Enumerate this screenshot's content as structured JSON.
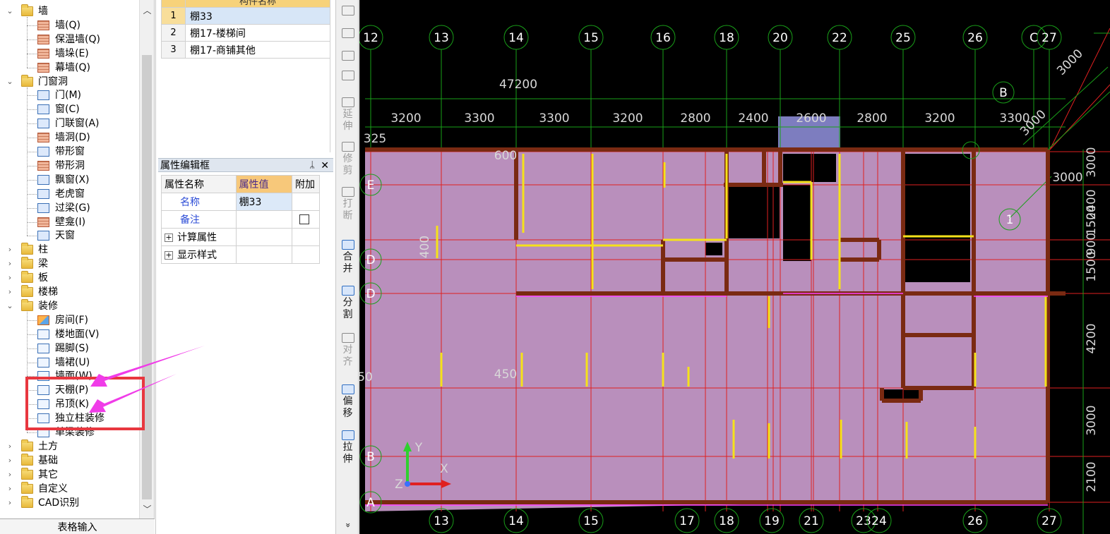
{
  "tree": {
    "items": [
      {
        "label": "墙",
        "type": "folder",
        "state": "open",
        "depth": 0
      },
      {
        "label": "墙(Q)",
        "type": "leaf",
        "icon": "brick-wall-icon",
        "style": "brick",
        "depth": 1
      },
      {
        "label": "保温墙(Q)",
        "type": "leaf",
        "icon": "insulated-wall-icon",
        "style": "brick",
        "depth": 1
      },
      {
        "label": "墙垛(E)",
        "type": "leaf",
        "icon": "wall-pier-icon",
        "style": "brick",
        "depth": 1
      },
      {
        "label": "幕墙(Q)",
        "type": "leaf",
        "icon": "curtain-wall-icon",
        "style": "brick",
        "depth": 1
      },
      {
        "label": "门窗洞",
        "type": "folder",
        "state": "open",
        "depth": 0
      },
      {
        "label": "门(M)",
        "type": "leaf",
        "icon": "door-icon",
        "style": "door",
        "depth": 1
      },
      {
        "label": "窗(C)",
        "type": "leaf",
        "icon": "window-icon",
        "style": "door",
        "depth": 1
      },
      {
        "label": "门联窗(A)",
        "type": "leaf",
        "icon": "door-window-icon",
        "style": "door",
        "depth": 1
      },
      {
        "label": "墙洞(D)",
        "type": "leaf",
        "icon": "wall-opening-icon",
        "style": "brick",
        "depth": 1
      },
      {
        "label": "带形窗",
        "type": "leaf",
        "icon": "strip-window-icon",
        "style": "door",
        "depth": 1
      },
      {
        "label": "带形洞",
        "type": "leaf",
        "icon": "strip-opening-icon",
        "style": "brick",
        "depth": 1
      },
      {
        "label": "飘窗(X)",
        "type": "leaf",
        "icon": "bay-window-icon",
        "style": "door",
        "depth": 1
      },
      {
        "label": "老虎窗",
        "type": "leaf",
        "icon": "dormer-window-icon",
        "style": "door",
        "depth": 1
      },
      {
        "label": "过梁(G)",
        "type": "leaf",
        "icon": "lintel-icon",
        "style": "door",
        "depth": 1
      },
      {
        "label": "壁龛(I)",
        "type": "leaf",
        "icon": "niche-icon",
        "style": "brick",
        "depth": 1
      },
      {
        "label": "天窗",
        "type": "leaf",
        "icon": "skylight-icon",
        "style": "door",
        "depth": 1
      },
      {
        "label": "柱",
        "type": "folder",
        "state": "closed",
        "depth": 0
      },
      {
        "label": "梁",
        "type": "folder",
        "state": "closed",
        "depth": 0
      },
      {
        "label": "板",
        "type": "folder",
        "state": "closed",
        "depth": 0
      },
      {
        "label": "楼梯",
        "type": "folder",
        "state": "closed",
        "depth": 0
      },
      {
        "label": "装修",
        "type": "folder",
        "state": "open",
        "depth": 0
      },
      {
        "label": "房间(F)",
        "type": "leaf",
        "icon": "room-icon",
        "style": "room",
        "depth": 1
      },
      {
        "label": "楼地面(V)",
        "type": "leaf",
        "icon": "floor-finish-icon",
        "style": "ceil",
        "depth": 1
      },
      {
        "label": "踢脚(S)",
        "type": "leaf",
        "icon": "skirting-icon",
        "style": "ceil",
        "depth": 1
      },
      {
        "label": "墙裙(U)",
        "type": "leaf",
        "icon": "wainscot-icon",
        "style": "ceil",
        "depth": 1
      },
      {
        "label": "墙面(W)",
        "type": "leaf",
        "icon": "wall-finish-icon",
        "style": "ceil",
        "depth": 1
      },
      {
        "label": "天棚(P)",
        "type": "leaf",
        "icon": "ceiling-icon",
        "style": "ceil",
        "depth": 1
      },
      {
        "label": "吊顶(K)",
        "type": "leaf",
        "icon": "suspended-ceiling-icon",
        "style": "ceil",
        "depth": 1
      },
      {
        "label": "独立柱装修",
        "type": "leaf",
        "icon": "column-finish-icon",
        "style": "ceil",
        "depth": 1
      },
      {
        "label": "单梁装修",
        "type": "leaf",
        "icon": "beam-finish-icon",
        "style": "ceil",
        "depth": 1
      },
      {
        "label": "土方",
        "type": "folder",
        "state": "closed",
        "depth": 0
      },
      {
        "label": "基础",
        "type": "folder",
        "state": "closed",
        "depth": 0
      },
      {
        "label": "其它",
        "type": "folder",
        "state": "closed",
        "depth": 0
      },
      {
        "label": "自定义",
        "type": "folder",
        "state": "closed",
        "depth": 0
      },
      {
        "label": "CAD识别",
        "type": "folder",
        "state": "closed",
        "depth": 0
      }
    ],
    "footer": "表格输入"
  },
  "component_list": {
    "header": "构件名称",
    "rows": [
      {
        "index": "1",
        "name": "棚33",
        "selected": true
      },
      {
        "index": "2",
        "name": "棚17-楼梯间",
        "selected": false
      },
      {
        "index": "3",
        "name": "棚17-商铺其他",
        "selected": false
      }
    ]
  },
  "property_panel": {
    "title": "属性编辑框",
    "pin": "ᛦ",
    "close": "✕",
    "columns": [
      "属性名称",
      "属性值",
      "附加"
    ],
    "rows": [
      {
        "name": "名称",
        "value": "棚33",
        "kind": "field"
      },
      {
        "name": "备注",
        "value": "",
        "kind": "checkbox"
      },
      {
        "name": "计算属性",
        "value": "",
        "kind": "group"
      },
      {
        "name": "显示样式",
        "value": "",
        "kind": "group"
      }
    ]
  },
  "toolbar": {
    "buttons": [
      {
        "label": "",
        "icon": "select-icon",
        "enabled": false
      },
      {
        "label": "",
        "icon": "mirror-icon",
        "enabled": false
      },
      {
        "label": "",
        "icon": "move-icon",
        "enabled": false
      },
      {
        "label": "",
        "icon": "rotate-icon",
        "enabled": false
      },
      {
        "label": "延伸",
        "icon": "extend-icon",
        "enabled": false
      },
      {
        "label": "修剪",
        "icon": "trim-icon",
        "enabled": false
      },
      {
        "label": "打断",
        "icon": "break-icon",
        "enabled": false
      },
      {
        "label": "合并",
        "icon": "merge-icon",
        "enabled": true
      },
      {
        "label": "分割",
        "icon": "split-icon",
        "enabled": true
      },
      {
        "label": "对齐",
        "icon": "align-icon",
        "enabled": false
      },
      {
        "label": "偏移",
        "icon": "offset-icon",
        "enabled": true
      },
      {
        "label": "拉伸",
        "icon": "stretch-icon",
        "enabled": true
      }
    ],
    "more": "»"
  },
  "drawing": {
    "top_axes": [
      "12",
      "13",
      "14",
      "15",
      "16",
      "18",
      "20",
      "22",
      "25",
      "26",
      "C",
      "27"
    ],
    "bottom_axes": [
      "13",
      "14",
      "15",
      "17",
      "18",
      "19",
      "21",
      "23",
      "24",
      "26",
      "27"
    ],
    "left_axes": [
      "E",
      "D",
      "D",
      "B",
      "A"
    ],
    "right_axes": [
      "B",
      "1"
    ],
    "overall_dim": "47200",
    "top_dims": [
      "3200",
      "3300",
      "3300",
      "3200",
      "2800",
      "2400",
      "2600",
      "2800",
      "3200",
      "3300"
    ],
    "right_dims": [
      "3000",
      "2400",
      "1500",
      "900",
      "1500",
      "4200",
      "3000",
      "2100"
    ],
    "diag_dims": [
      "3000",
      "3000"
    ],
    "other_dims": [
      "325",
      "600",
      "400",
      "450",
      "50"
    ],
    "ucs": {
      "x": "X",
      "y": "Y",
      "z": "Z"
    },
    "colors": {
      "background": "#000000",
      "room": "#b98fbc",
      "wall": "#7a2a12",
      "grid": "#e02020",
      "axis": "#19a019",
      "highlight": "#f5e21a"
    }
  },
  "annotation": {
    "color": "#e8373f",
    "arrow_color": "#f03ce8"
  }
}
